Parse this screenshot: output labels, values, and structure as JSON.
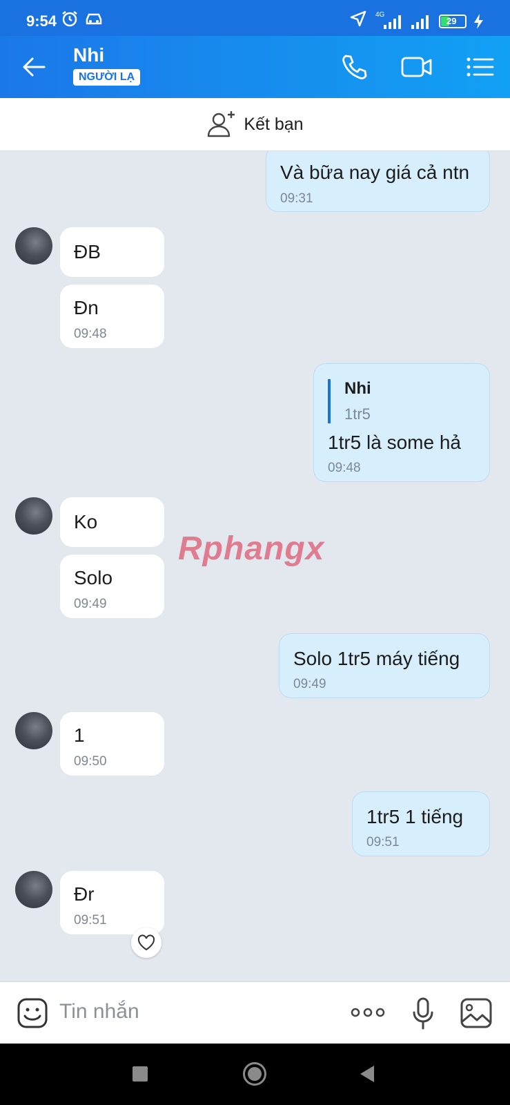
{
  "status_bar": {
    "time": "9:54",
    "network": "4G",
    "battery": "29"
  },
  "header": {
    "contact_name": "Nhi",
    "badge": "NGƯỜI LẠ"
  },
  "add_friend": {
    "label": "Kết bạn"
  },
  "messages": {
    "m1": {
      "text": "Và bữa nay giá cả ntn",
      "time": "09:31"
    },
    "m2": {
      "text": "ĐB"
    },
    "m3": {
      "text": "Đn",
      "time": "09:48"
    },
    "m4": {
      "quote_name": "Nhi",
      "quote_text": "1tr5",
      "text": "1tr5 là some hả",
      "time": "09:48"
    },
    "m5": {
      "text": "Ko"
    },
    "m6": {
      "text": "Solo",
      "time": "09:49"
    },
    "m7": {
      "text": "Solo 1tr5 máy tiếng",
      "time": "09:49"
    },
    "m8": {
      "text": "1",
      "time": "09:50"
    },
    "m9": {
      "text": "1tr5 1 tiếng",
      "time": "09:51"
    },
    "m10": {
      "text": "Đr",
      "time": "09:51"
    }
  },
  "watermark": "Rphangx",
  "composer": {
    "placeholder": "Tin nhắn"
  },
  "colors": {
    "accent": "#1a72e0",
    "outgoing_bubble": "#d7eefd",
    "incoming_bubble": "#ffffff",
    "chat_bg": "#e3e8ef"
  },
  "icons": [
    "alarm-icon",
    "car-icon",
    "location-icon",
    "signal-icon",
    "battery-icon",
    "charging-icon",
    "back-arrow-icon",
    "phone-icon",
    "video-call-icon",
    "menu-icon",
    "add-friend-icon",
    "heart-icon",
    "sticker-icon",
    "more-icon",
    "microphone-icon",
    "image-icon",
    "recent-apps-icon",
    "home-icon",
    "back-nav-icon"
  ]
}
